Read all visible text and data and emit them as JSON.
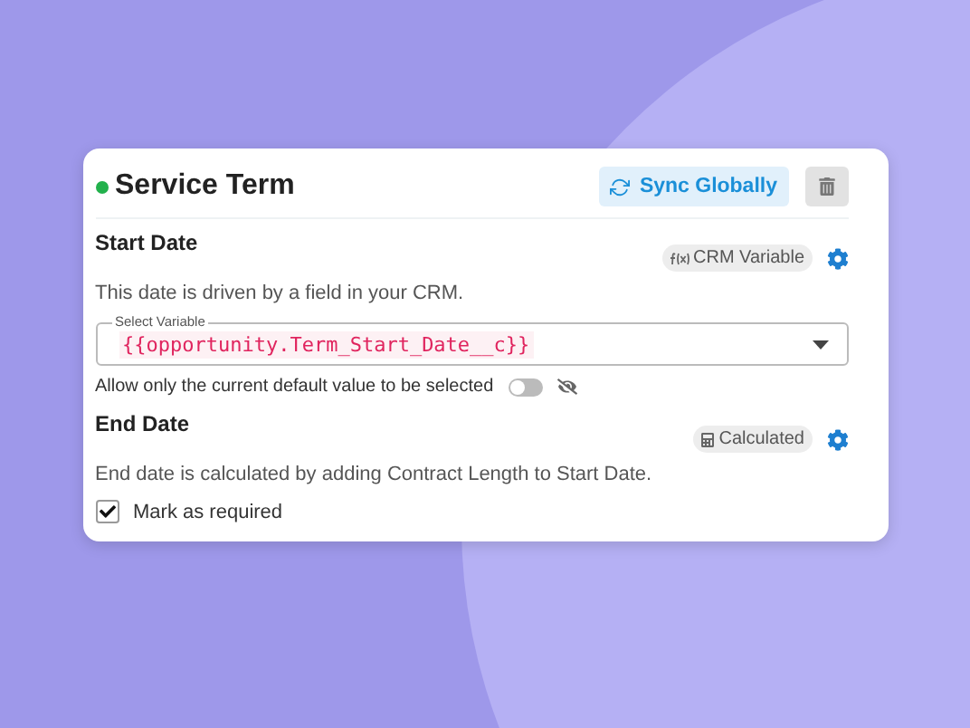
{
  "card": {
    "title": "Service Term",
    "color": "#22b14c",
    "sync_button": "Sync Globally"
  },
  "start_date": {
    "label": "Start Date",
    "badge": "CRM Variable",
    "description": "This date is driven by a field in your CRM.",
    "select": {
      "legend": "Select Variable",
      "value": "{{opportunity.Term_Start_Date__c}}"
    },
    "toggle": {
      "label": "Allow only the current default value to be selected",
      "on": false
    }
  },
  "end_date": {
    "label": "End Date",
    "badge": "Calculated",
    "description": "End date is calculated by adding Contract Length to Start Date.",
    "required": {
      "label": "Mark as required",
      "checked": true
    }
  }
}
